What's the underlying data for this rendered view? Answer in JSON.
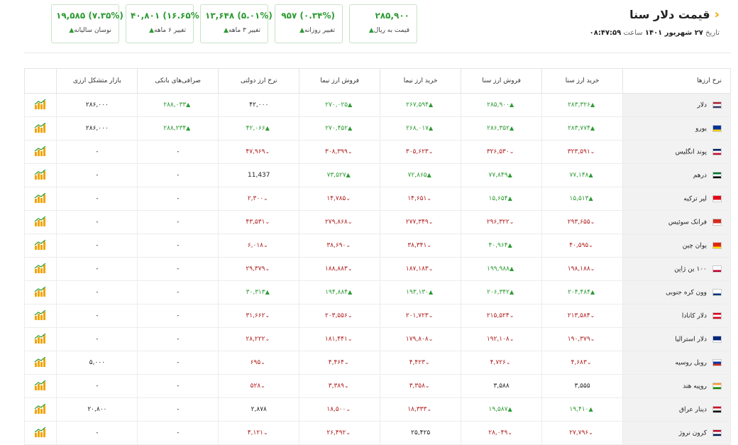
{
  "header": {
    "title": "قیمت دلار سنا",
    "date_prefix": "تاریخ",
    "date_value": "۲۷ شهریور ۱۴۰۱",
    "time_prefix": "ساعت",
    "time_value": "۰۸:۴۷:۵۹"
  },
  "cards": [
    {
      "value": "۲۸۵,۹۰۰",
      "label": "قیمت به ریال"
    },
    {
      "value": "۹۵۷ (۰.۳۴%)",
      "label": "تغییر روزانه"
    },
    {
      "value": "۱۳,۶۴۸ (۵.۰۱%)",
      "label": "تغییر ۳ ماهه"
    },
    {
      "value": "۴۰,۸۰۱ (۱۶.۶۵%)",
      "label": "تغییر ۶ ماهه"
    },
    {
      "value": "۱۹,۵۸۵ (۷.۳۵%)",
      "label": "نوسان سالیانه"
    }
  ],
  "table": {
    "headers": [
      "نرخ ارزها",
      "خرید ارز سنا",
      "فروش ارز سنا",
      "خرید ارز نیما",
      "فروش ارز نیما",
      "نرخ ارز دولتی",
      "صرافی‌های بانکی",
      "بازار متشکل ارزی",
      ""
    ],
    "rows": [
      {
        "name": "دلار",
        "flag": "us",
        "cells": [
          [
            "۲۸۳,۳۲۶",
            "up"
          ],
          [
            "۲۸۵,۹۰۰",
            "up"
          ],
          [
            "۲۶۷,۵۹۴",
            "up"
          ],
          [
            "۲۷۰,۰۲۵",
            "up"
          ],
          [
            "۴۲,۰۰۰",
            ""
          ],
          [
            "۲۸۸,۰۳۳",
            "up"
          ],
          [
            "۲۸۶,۰۰۰",
            ""
          ]
        ]
      },
      {
        "name": "یورو",
        "flag": "eu",
        "cells": [
          [
            "۲۸۳,۷۷۴",
            "up"
          ],
          [
            "۲۸۶,۳۵۲",
            "up"
          ],
          [
            "۲۶۸,۰۱۷",
            "up"
          ],
          [
            "۲۷۰,۴۵۲",
            "up"
          ],
          [
            "۴۲,۰۶۶",
            "up"
          ],
          [
            "۲۸۸,۲۳۴",
            "up"
          ],
          [
            "۲۸۶,۰۰۰",
            ""
          ]
        ]
      },
      {
        "name": "پوند انگلیس",
        "flag": "gb",
        "cells": [
          [
            "۳۲۳,۵۹۱",
            "down"
          ],
          [
            "۳۲۶,۵۳۰",
            "down"
          ],
          [
            "۳۰۵,۶۲۳",
            "down"
          ],
          [
            "۳۰۸,۳۹۹",
            "down"
          ],
          [
            "۴۷,۹۶۹",
            "down"
          ],
          [
            "-",
            ""
          ],
          [
            "-",
            ""
          ]
        ]
      },
      {
        "name": "درهم",
        "flag": "ae",
        "cells": [
          [
            "۷۷,۱۴۸",
            "up"
          ],
          [
            "۷۷,۸۴۹",
            "up"
          ],
          [
            "۷۲,۸۶۵",
            "up"
          ],
          [
            "۷۳,۵۲۷",
            "up"
          ],
          [
            "11,437",
            ""
          ],
          [
            "-",
            ""
          ],
          [
            "-",
            ""
          ]
        ]
      },
      {
        "name": "لیر ترکیه",
        "flag": "tr",
        "cells": [
          [
            "۱۵,۵۱۳",
            "up"
          ],
          [
            "۱۵,۶۵۴",
            "up"
          ],
          [
            "۱۴,۶۵۱",
            "down"
          ],
          [
            "۱۴,۷۸۵",
            "down"
          ],
          [
            "۲,۳۰۰",
            "down"
          ],
          [
            "-",
            ""
          ],
          [
            "-",
            ""
          ]
        ]
      },
      {
        "name": "فرانک سوئیس",
        "flag": "ch",
        "cells": [
          [
            "۲۹۳,۶۵۵",
            "down"
          ],
          [
            "۲۹۶,۳۲۲",
            "down"
          ],
          [
            "۲۷۷,۳۴۹",
            "down"
          ],
          [
            "۲۷۹,۸۶۸",
            "down"
          ],
          [
            "۴۳,۵۳۱",
            "down"
          ],
          [
            "-",
            ""
          ],
          [
            "-",
            ""
          ]
        ]
      },
      {
        "name": "یوان چین",
        "flag": "cn",
        "cells": [
          [
            "۴۰,۵۹۵",
            "down"
          ],
          [
            "۴۰,۹۶۴",
            "up"
          ],
          [
            "۳۸,۳۴۱",
            "down"
          ],
          [
            "۳۸,۶۹۰",
            "down"
          ],
          [
            "۶,۰۱۸",
            "down"
          ],
          [
            "-",
            ""
          ],
          [
            "-",
            ""
          ]
        ]
      },
      {
        "name": "۱۰۰ ین ژاپن",
        "flag": "jp",
        "cells": [
          [
            "۱۹۸,۱۸۸",
            "down"
          ],
          [
            "۱۹۹,۹۸۸",
            "up"
          ],
          [
            "۱۸۷,۱۸۳",
            "down"
          ],
          [
            "۱۸۸,۸۸۳",
            "down"
          ],
          [
            "۲۹,۳۷۹",
            "down"
          ],
          [
            "-",
            ""
          ],
          [
            "-",
            ""
          ]
        ]
      },
      {
        "name": "وون کره جنوبی",
        "flag": "kr",
        "cells": [
          [
            "۲۰۴,۴۸۴",
            "up"
          ],
          [
            "۲۰۶,۳۴۲",
            "up"
          ],
          [
            "۱۹۳,۱۳۰",
            "up"
          ],
          [
            "۱۹۴,۸۸۴",
            "up"
          ],
          [
            "۳۰,۳۱۳",
            "up"
          ],
          [
            "-",
            ""
          ],
          [
            "-",
            ""
          ]
        ]
      },
      {
        "name": "دلار کانادا",
        "flag": "ca",
        "cells": [
          [
            "۲۱۳,۵۸۴",
            "down"
          ],
          [
            "۲۱۵,۵۲۴",
            "down"
          ],
          [
            "۲۰۱,۷۲۳",
            "down"
          ],
          [
            "۲۰۳,۵۵۶",
            "down"
          ],
          [
            "۳۱,۶۶۲",
            "down"
          ],
          [
            "-",
            ""
          ],
          [
            "-",
            ""
          ]
        ]
      },
      {
        "name": "دلار استرالیا",
        "flag": "au",
        "cells": [
          [
            "۱۹۰,۳۷۹",
            "down"
          ],
          [
            "۱۹۲,۱۰۸",
            "down"
          ],
          [
            "۱۷۹,۸۰۸",
            "down"
          ],
          [
            "۱۸۱,۴۴۱",
            "down"
          ],
          [
            "۲۸,۲۲۲",
            "down"
          ],
          [
            "-",
            ""
          ],
          [
            "-",
            ""
          ]
        ]
      },
      {
        "name": "روبل روسیه",
        "flag": "ru",
        "cells": [
          [
            "۴,۶۸۳",
            "down"
          ],
          [
            "۴,۷۲۶",
            "down"
          ],
          [
            "۴,۴۲۳",
            "down"
          ],
          [
            "۴,۴۶۴",
            "down"
          ],
          [
            "۶۹۵",
            "down"
          ],
          [
            "-",
            ""
          ],
          [
            "۵,۰۰۰",
            ""
          ]
        ]
      },
      {
        "name": "روپیه هند",
        "flag": "in",
        "cells": [
          [
            "۳,۵۵۵",
            ""
          ],
          [
            "۳,۵۸۸",
            ""
          ],
          [
            "۳,۳۵۸",
            "down"
          ],
          [
            "۳,۳۸۹",
            "down"
          ],
          [
            "۵۲۸",
            "down"
          ],
          [
            "-",
            ""
          ],
          [
            "-",
            ""
          ]
        ]
      },
      {
        "name": "دینار عراق",
        "flag": "iq",
        "cells": [
          [
            "۱۹,۴۱۰",
            "up"
          ],
          [
            "۱۹,۵۸۷",
            "up"
          ],
          [
            "۱۸,۳۳۳",
            "down"
          ],
          [
            "۱۸,۵۰۰",
            "down"
          ],
          [
            "۲,۸۷۸",
            ""
          ],
          [
            "-",
            ""
          ],
          [
            "۲۰,۸۰۰",
            ""
          ]
        ]
      },
      {
        "name": "کرون نروژ",
        "flag": "no",
        "cells": [
          [
            "۲۷,۷۹۶",
            "down"
          ],
          [
            "۲۸,۰۴۹",
            "down"
          ],
          [
            "۲۵,۴۲۵",
            ""
          ],
          [
            "۲۶,۴۹۲",
            "down"
          ],
          [
            "۴,۱۲۱",
            "down"
          ],
          [
            "-",
            ""
          ],
          [
            "-",
            ""
          ]
        ]
      }
    ]
  },
  "colors": {
    "up": "#2e9b34",
    "down": "#b02020",
    "accent": "#f0a500"
  },
  "icons": {
    "chart": "bar-chart-icon",
    "back": "chevron-right-icon",
    "up": "arrow-up-icon",
    "down": "chevron-down-icon"
  }
}
